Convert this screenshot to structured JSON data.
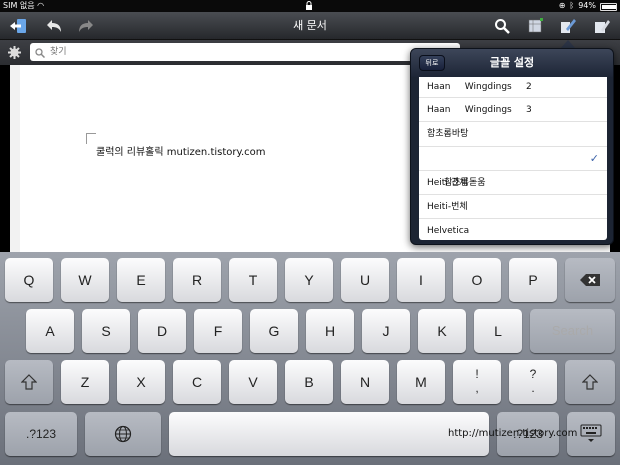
{
  "status": {
    "carrier": "SIM 없음",
    "battery": "94%",
    "battery_level": 0.94
  },
  "toolbar": {
    "title": "새 문서"
  },
  "search": {
    "placeholder": "찾기"
  },
  "document": {
    "text": "쿨럭의 리뷰홀릭 mutizen.tistory.com"
  },
  "font_popover": {
    "back_label": "뒤로",
    "title": "글꼴 설정",
    "items": [
      {
        "label": "Haan     Wingdings     2",
        "selected": false
      },
      {
        "label": "Haan     Wingdings     3",
        "selected": false
      },
      {
        "label": "함초롬바탕",
        "selected": false
      },
      {
        "label": "함초롬돋움",
        "selected": true
      },
      {
        "label": "Heiti-간체",
        "selected": false
      },
      {
        "label": "Heiti-번체",
        "selected": false
      },
      {
        "label": "Helvetica",
        "selected": false
      }
    ]
  },
  "keyboard": {
    "row1": [
      "Q",
      "W",
      "E",
      "R",
      "T",
      "Y",
      "U",
      "I",
      "O",
      "P"
    ],
    "row2": [
      "A",
      "S",
      "D",
      "F",
      "G",
      "H",
      "J",
      "K",
      "L"
    ],
    "row3": [
      "Z",
      "X",
      "C",
      "V",
      "B",
      "N",
      "M"
    ],
    "exclam": "!\n,",
    "question": "?\n.",
    "search_label": "Search",
    "numbers_label": ".?123",
    "numbers_label_right": ".?123"
  },
  "watermark": "http://mutizen.tistory.com"
}
